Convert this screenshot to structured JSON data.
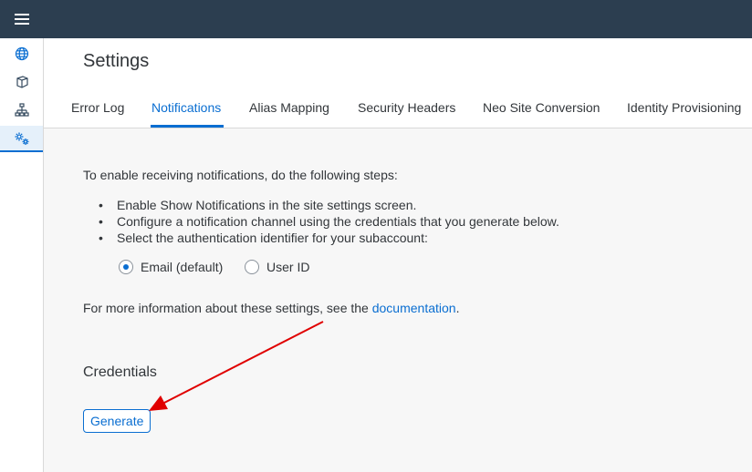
{
  "shell": {
    "menu_icon": "hamburger-menu-icon",
    "background": "#2c3e50"
  },
  "sidenav": {
    "items": [
      {
        "name": "globe",
        "icon": "globe-icon",
        "active": false
      },
      {
        "name": "cube",
        "icon": "cube-icon",
        "active": false
      },
      {
        "name": "hierarchy",
        "icon": "hierarchy-icon",
        "active": false
      },
      {
        "name": "settings",
        "icon": "settings-gears-icon",
        "active": true
      }
    ]
  },
  "page": {
    "title": "Settings"
  },
  "tabs": [
    {
      "label": "Error Log",
      "active": false
    },
    {
      "label": "Notifications",
      "active": true
    },
    {
      "label": "Alias Mapping",
      "active": false
    },
    {
      "label": "Security Headers",
      "active": false
    },
    {
      "label": "Neo Site Conversion",
      "active": false
    },
    {
      "label": "Identity Provisioning",
      "active": false
    }
  ],
  "notifications": {
    "intro": "To enable receiving notifications, do the following steps:",
    "steps": [
      "Enable Show Notifications in the site settings screen.",
      "Configure a notification channel using the credentials that you generate below.",
      "Select the authentication identifier for your subaccount:"
    ],
    "identifier_options": [
      {
        "label": "Email (default)",
        "selected": true
      },
      {
        "label": "User ID",
        "selected": false
      }
    ],
    "more_info_prefix": "For more information about these settings, see the ",
    "more_info_link": "documentation",
    "more_info_suffix": "."
  },
  "credentials": {
    "title": "Credentials",
    "generate_label": "Generate"
  },
  "colors": {
    "accent": "#0a6ed1",
    "annotation_arrow": "#e00000"
  }
}
